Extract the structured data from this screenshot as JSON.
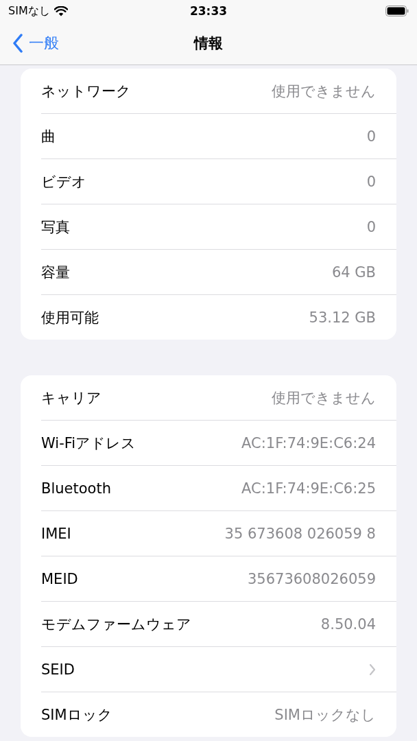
{
  "status_bar": {
    "carrier": "SIMなし",
    "time": "23:33"
  },
  "nav": {
    "back": "一般",
    "title": "情報"
  },
  "groups": [
    {
      "rows": [
        {
          "label": "ネットワーク",
          "value": "使用できません",
          "kind": "value"
        },
        {
          "label": "曲",
          "value": "0",
          "kind": "value"
        },
        {
          "label": "ビデオ",
          "value": "0",
          "kind": "value"
        },
        {
          "label": "写真",
          "value": "0",
          "kind": "value"
        },
        {
          "label": "容量",
          "value": "64 GB",
          "kind": "value"
        },
        {
          "label": "使用可能",
          "value": "53.12 GB",
          "kind": "value"
        }
      ]
    },
    {
      "rows": [
        {
          "label": "キャリア",
          "value": "使用できません",
          "kind": "value"
        },
        {
          "label": "Wi-Fiアドレス",
          "value": "AC:1F:74:9E:C6:24",
          "kind": "value"
        },
        {
          "label": "Bluetooth",
          "value": "AC:1F:74:9E:C6:25",
          "kind": "value"
        },
        {
          "label": "IMEI",
          "value": "35 673608 026059 8",
          "kind": "value"
        },
        {
          "label": "MEID",
          "value": "35673608026059",
          "kind": "value"
        },
        {
          "label": "モデムファームウェア",
          "value": "8.50.04",
          "kind": "value"
        },
        {
          "label": "SEID",
          "kind": "disclosure"
        },
        {
          "label": "SIMロック",
          "value": "SIMロックなし",
          "kind": "value"
        }
      ]
    }
  ]
}
